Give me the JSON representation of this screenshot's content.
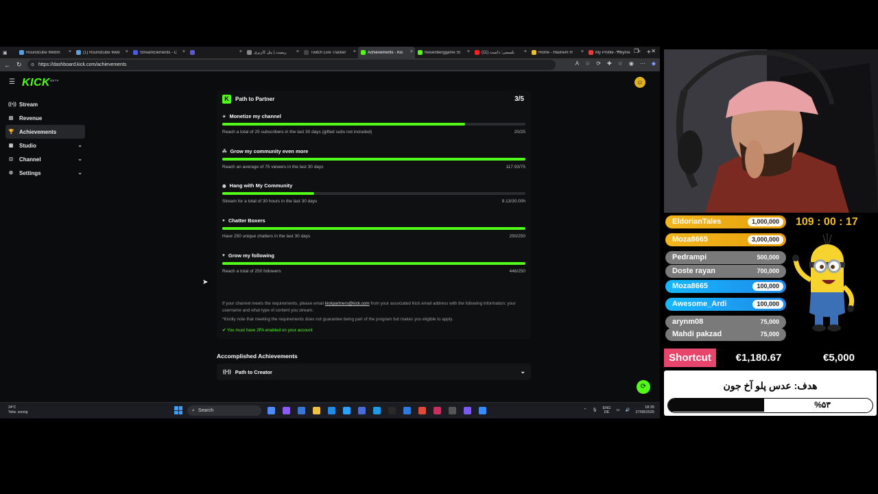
{
  "browser": {
    "tabs": [
      {
        "title": "Roundcube Webm",
        "color": "#5aa0e0",
        "active": false
      },
      {
        "title": "(1) Roundcube Web",
        "color": "#5aa0e0",
        "active": false
      },
      {
        "title": "StreamElements - C",
        "color": "#4a5ad8",
        "active": false
      },
      {
        "title": "",
        "color": "#5a5ad8",
        "active": false
      },
      {
        "title": "ریمیت | پنل کاربری",
        "color": "#888888",
        "active": false
      },
      {
        "title": "Twitch Live Tracker",
        "color": "#444444",
        "active": false
      },
      {
        "title": "Achievements - Kic",
        "color": "#53fc18",
        "active": true
      },
      {
        "title": "heisenberggame St",
        "color": "#53fc18",
        "active": false
      },
      {
        "title": "(11) بلسمی: داست",
        "color": "#ff2020",
        "active": false
      },
      {
        "title": "Home - Hashem H",
        "color": "#f0c020",
        "active": false
      },
      {
        "title": "My Profile - Keyme",
        "color": "#e04040",
        "active": false
      }
    ],
    "url": "https://dashboard.kick.com/achievements"
  },
  "kick": {
    "logo": "KICK",
    "logo_beta": "BETA",
    "sidebar": [
      {
        "label": "Stream",
        "icon": "stream-icon",
        "glyph": "((•))",
        "active": false,
        "chevron": false
      },
      {
        "label": "Revenue",
        "icon": "revenue-icon",
        "glyph": "▤",
        "active": false,
        "chevron": false
      },
      {
        "label": "Achievements",
        "icon": "trophy-icon",
        "glyph": "🏆",
        "active": true,
        "chevron": false
      },
      {
        "label": "Studio",
        "icon": "studio-icon",
        "glyph": "▦",
        "active": false,
        "chevron": true
      },
      {
        "label": "Channel",
        "icon": "channel-icon",
        "glyph": "⊡",
        "active": false,
        "chevron": true
      },
      {
        "label": "Settings",
        "icon": "gear-icon",
        "glyph": "⚙",
        "active": false,
        "chevron": true
      }
    ],
    "card": {
      "title": "Path to Partner",
      "progress": "3/5"
    },
    "achievements": [
      {
        "title": "Monetize my channel",
        "icon": "sparkle-icon",
        "glyph": "✦",
        "desc": "Reach a total of 25 subscribers in the last 30 days (gifted subs not included)",
        "value": "20/25",
        "fraction": 0.8
      },
      {
        "title": "Grow my community even more",
        "icon": "community-icon",
        "glyph": "⁂",
        "desc": "Reach an average of 75 viewers in the last 30 days",
        "value": "117.93/75",
        "fraction": 1.0
      },
      {
        "title": "Hang with My Community",
        "icon": "broadcast-icon",
        "glyph": "◉",
        "desc": "Stream for a total of 30 hours in the last 30 days",
        "value": "9.13/30.00h",
        "fraction": 0.304
      },
      {
        "title": "Chatter Boxers",
        "icon": "chat-icon",
        "glyph": "●",
        "desc": "Have 250 unique chatters in the last 30 days",
        "value": "250/250",
        "fraction": 1.0
      },
      {
        "title": "Grow my following",
        "icon": "heart-icon",
        "glyph": "♥",
        "desc": "Reach a total of 250 followers",
        "value": "446/250",
        "fraction": 1.0
      }
    ],
    "note_pre": "If your channel meets the requirements, please email ",
    "note_email": "kickpartners@kick.com",
    "note_post": " from your associated Kick email address with the following information: your username and what type of content you stream.",
    "note2": "*Kindly note that meeting the requirements does not guarantee being part of the program but makes you eligible to apply.",
    "twofa": "You must have 2FA enabled on your account",
    "accomplished_title": "Accomplished Achievements",
    "accomplished_item": "Path to Creator"
  },
  "taskbar": {
    "weather_temp": "24°C",
    "weather_desc": "Teilw. sonnig",
    "search": "Search",
    "lang1": "ENG",
    "lang2": "DE",
    "time": "18:35",
    "date": "27/08/2025",
    "app_colors": [
      "#4c8cff",
      "#8a5cf6",
      "#3a78d8",
      "#f0c040",
      "#1f8ae8",
      "#2aa1ff",
      "#4a6cd8",
      "#1c9be8",
      "#2a2a2a",
      "#2d7ae0",
      "#e04a3a",
      "#c83060",
      "#555555",
      "#7a5af0",
      "#3a8aff"
    ]
  },
  "overlay": {
    "donors": [
      {
        "name": "EldorianTales",
        "amount": "1,000,000",
        "style": "gold"
      },
      {
        "name": "Moza8665",
        "amount": "3,000,000",
        "style": "gold"
      },
      {
        "name": "Pedrampi",
        "amount": "500,000",
        "style": "gray"
      },
      {
        "name": "Doste rayan",
        "amount": "700,000",
        "style": "gray"
      },
      {
        "name": "Moza8665",
        "amount": "100,000",
        "style": "blue"
      },
      {
        "name": "Awesome_Ardi",
        "amount": "100,000",
        "style": "blue"
      },
      {
        "name": "arynm08",
        "amount": "75,000",
        "style": "gray"
      },
      {
        "name": "Mahdi pakzad",
        "amount": "75,000",
        "style": "gray"
      }
    ],
    "timer": "109 : 00 : 17",
    "shortcut_label": "Shortcut",
    "shortcut_current": "€1,180.67",
    "shortcut_goal": "€5,000",
    "goal_text": "هدف: عدس پلو آخ جون",
    "goal_percent": "%۵۳",
    "goal_fraction": 0.53
  }
}
